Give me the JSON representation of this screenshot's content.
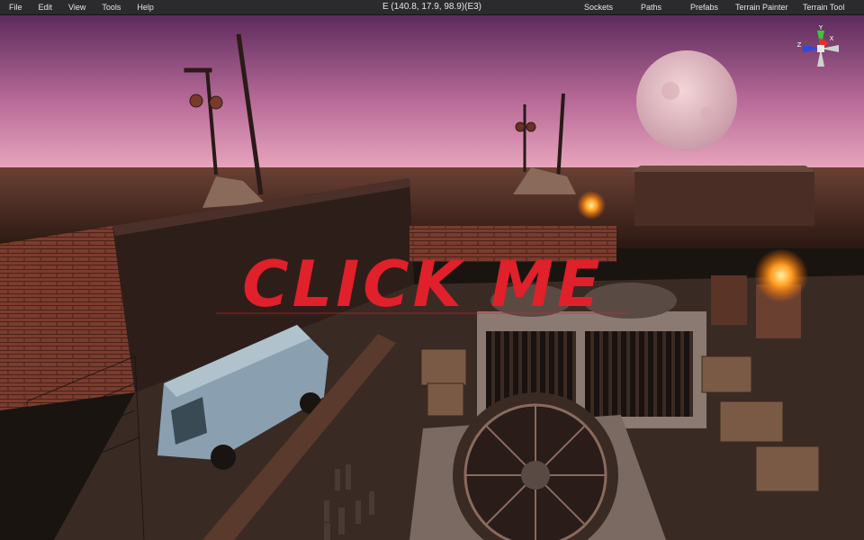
{
  "menubar": {
    "items": [
      "File",
      "Edit",
      "View",
      "Tools",
      "Help"
    ],
    "camera_coords": "E (140.8, 17.9, 98.9)(E3)",
    "tools": [
      "Sockets",
      "Paths",
      "Prefabs",
      "Terrain Painter",
      "Terrain Tool"
    ]
  },
  "overlay": {
    "button_text": "CLICK ME",
    "button_color": "#e0202a"
  },
  "gizmo": {
    "y_label": "Y",
    "x_label": "X",
    "z_label": "Z"
  },
  "scene": {
    "sky_top": "#5a2a5a",
    "sky_horizon": "#e8a0b8",
    "ground": "#3a2418"
  }
}
